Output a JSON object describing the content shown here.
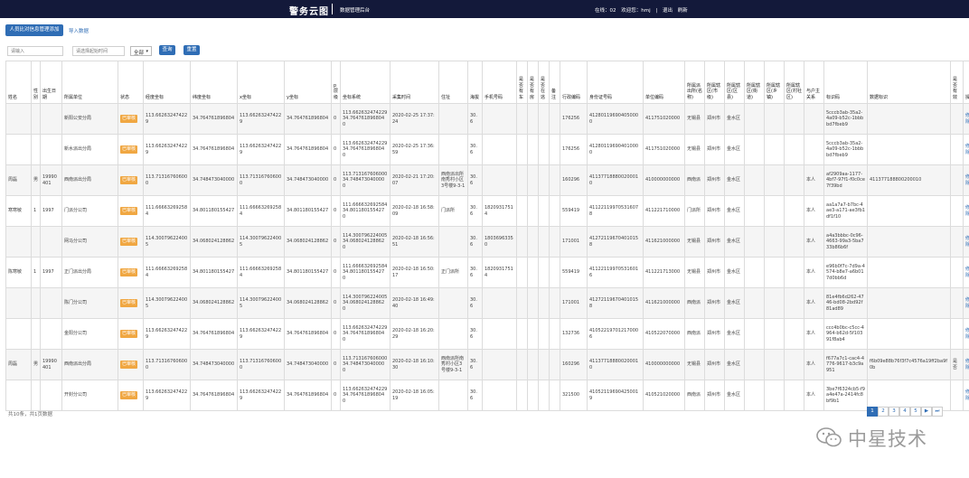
{
  "header": {
    "title": "警务云图",
    "subtitle": "数据管理后台",
    "user_info": "在线：02 欢迎您：hmj | 退出 刷新"
  },
  "toolbar": {
    "add_label": "人员比对信息管理添加",
    "import_label": "导入数据",
    "search_placeholder": "请输入",
    "search2_placeholder": "请选择起始时间",
    "select_value": "全部",
    "query_label": "查询",
    "reset_label": "重置"
  },
  "table": {
    "columns": [
      "姓名",
      "性别",
      "出生日期",
      "所属单位",
      "状态",
      "经度坐标",
      "纬度坐标",
      "x坐标",
      "y坐标",
      "p 层 级",
      "坐标系统",
      "采集时间",
      "住址",
      "海拔",
      "手机号码",
      "是否有车",
      "是否有房",
      "是否在逃",
      "备注",
      "行政编码",
      "身份证号码",
      "单位编码",
      "所属派出所(名称)",
      "所属辖区(市级)",
      "所属辖区(区县)",
      "所属辖区(街道)",
      "所属辖区(乡镇)",
      "所属辖区(村社区)",
      "与户主关系",
      "标识码",
      "数据标识",
      "是否有效",
      "操作"
    ],
    "rows": [
      [
        "",
        "",
        "",
        "新阳公安分局",
        "已审核",
        "113.662632474229",
        "34.764761896804",
        "113.662632474229",
        "34.764761896804",
        "0",
        "113.662632474229 34.764761896804 0",
        "2020-02-25 17:37:24",
        "",
        "30.6",
        "",
        "",
        "",
        "",
        "",
        "176256",
        "412801196904050000",
        "411751020000",
        "无锡县",
        "郑州市",
        "金水区",
        "",
        "",
        "",
        "",
        "5cccb3ab-35a2-4a09-b52c-1bbbbd7fbeb9",
        "",
        "",
        "修改|删除"
      ],
      [
        "",
        "",
        "",
        "新水派出分局",
        "已审核",
        "113.662632474229",
        "34.764761896804",
        "113.662632474229",
        "34.764761896804",
        "0",
        "113.662632474229 34.764761896804 0",
        "2020-02-25 17:36:59",
        "",
        "30.6",
        "",
        "",
        "",
        "",
        "",
        "176256",
        "412801196904010000",
        "411751020000",
        "无锡县",
        "郑州市",
        "金水区",
        "",
        "",
        "",
        "",
        "5cccb3ab-35a2-4a09-b52c-1bbbbd7fbeb9",
        "",
        "",
        "修改|删除"
      ],
      [
        "周磊",
        "男",
        "19990401",
        "西南派出分局",
        "已审核",
        "113.713167606000",
        "34.748473040000",
        "113.713167606000",
        "34.748473040000",
        "0",
        "113.713167606000 34.748473040000 0",
        "2020-02-21 17:20:07",
        "西南派出所南秀村小区3号楼9-3-1",
        "30.6",
        "",
        "",
        "",
        "",
        "",
        "160296",
        "411377188800200010",
        "410000000000",
        "西南派",
        "郑州市",
        "金水区",
        "",
        "",
        "",
        "本人",
        "af2909aa-1177-4bf7-97f1-f0c0ce7f39bd",
        "411377188800200010",
        "",
        "修改|删除"
      ],
      [
        "寒寒敏",
        "1",
        "1997",
        "门派分公司",
        "已审核",
        "111.666632692584",
        "34.801180155427",
        "111.666632692584",
        "34.801180155427",
        "0",
        "111.666632692584 34.801180155427 0",
        "2020-02-18 16:58:09",
        "门派所",
        "30.6",
        "18209317514",
        "",
        "",
        "",
        "",
        "559419",
        "411221199705316078",
        "411221710000",
        "门派所",
        "郑州市",
        "金水区",
        "",
        "",
        "",
        "本人",
        "aa1a7a7-b7bc-4ae3-a171-ae3fb1df1f10",
        "",
        "",
        "修改|删除"
      ],
      [
        "",
        "",
        "",
        "网马分公司",
        "已审核",
        "114.300796224005",
        "34.068024128862",
        "114.300796224005",
        "34.068024128862",
        "0",
        "114.300796224005 34.068024128862 0",
        "2020-02-18 16:56:51",
        "",
        "30.6",
        "18036963350",
        "",
        "",
        "",
        "",
        "171001",
        "412721196704010158",
        "411621000000",
        "无锡县",
        "郑州市",
        "金水区",
        "",
        "",
        "",
        "本人",
        "a4a3bbbc-0c96-4663-99a3-5ba733b86b6f",
        "",
        "",
        "修改|删除"
      ],
      [
        "陈寒敏",
        "1",
        "1997",
        "正门派出分局",
        "已审核",
        "111.666632692584",
        "34.801180155427",
        "111.666632692584",
        "34.801180155427",
        "0",
        "111.666632692584 34.801180155427 0",
        "2020-02-18 16:50:17",
        "正门派所",
        "30.6",
        "18209317514",
        "",
        "",
        "",
        "",
        "559419",
        "411221199705316016",
        "411221713000",
        "无锡县",
        "郑州市",
        "金水区",
        "",
        "",
        "",
        "本人",
        "e96b0f7c-7d9a-4574-b8e7-a6b017d0bb6d",
        "",
        "",
        "修改|删除"
      ],
      [
        "",
        "",
        "",
        "陈门分公司",
        "已审核",
        "114.300796224005",
        "34.068024128862",
        "114.300796224005",
        "34.068024128862",
        "0",
        "114.300796224005 34.068024128862 0",
        "2020-02-18 16:49:40",
        "",
        "30.6",
        "",
        "",
        "",
        "",
        "",
        "171001",
        "412721196704010158",
        "411621000000",
        "西南派",
        "郑州市",
        "金水区",
        "",
        "",
        "",
        "本人",
        "81e4fb6d262-4746-bd08-2bd92f81ad89",
        "",
        "",
        "修改|删除"
      ],
      [
        "",
        "",
        "",
        "金阳分公司",
        "已审核",
        "113.662632474229",
        "34.764761896804",
        "113.662632474229",
        "34.764761896804",
        "0",
        "113.662632474229 34.764761896804 0",
        "2020-02-18 16:20:29",
        "",
        "30.6",
        "",
        "",
        "",
        "",
        "",
        "132736",
        "410522197012170006",
        "410522070000",
        "西南派",
        "郑州市",
        "金水区",
        "",
        "",
        "",
        "本人",
        "ccc4b0bc-c5cc-4964-b62d-5f10391f8ab4",
        "",
        "",
        "修改|删除"
      ],
      [
        "周磊",
        "男",
        "19990401",
        "西南派出分局",
        "已审核",
        "113.713167606000",
        "34.748473040000",
        "113.713167606000",
        "34.748473040000",
        "0",
        "113.713167606000 34.748473040000 0",
        "2020-02-18 16:10:30",
        "西南派所南秀村小区3号楼9-3-1",
        "30.6",
        "",
        "",
        "",
        "",
        "",
        "160296",
        "411377188800200010",
        "410000000000",
        "无锡县",
        "郑州市",
        "金水区",
        "",
        "",
        "",
        "本人",
        "f677a7c1-cac4-4776-9617-b3c9a951",
        "f6b09e88b76f3f7c4576a19ff2ba9f0b",
        "是否",
        "修改|删除"
      ],
      [
        "",
        "",
        "",
        "开封分公司",
        "已审核",
        "113.662632474229",
        "34.764761896804",
        "113.662632474229",
        "34.764761896804",
        "0",
        "113.662632474229 34.764761896804 0",
        "2020-02-18 16:05:19",
        "",
        "30.6",
        "",
        "",
        "",
        "",
        "",
        "321500",
        "410521196904250019",
        "410521020000",
        "西南派",
        "郑州市",
        "金水区",
        "",
        "",
        "",
        "本人",
        "3be7f6324cb5-f9a4e47a-2414fc8bf9b1",
        "",
        "",
        "修改|删除"
      ]
    ]
  },
  "footer": {
    "summary": "共10条，共1页数据"
  },
  "pagination": {
    "pages": [
      "1",
      "2",
      "3",
      "4",
      "5"
    ],
    "next": "▶",
    "last": "⏭"
  },
  "watermark": {
    "text": "中星技术"
  },
  "colors": {
    "topbar": "#13193a",
    "primary": "#2f6db5",
    "badge": "#f0a742",
    "delete": "#d9534f"
  }
}
